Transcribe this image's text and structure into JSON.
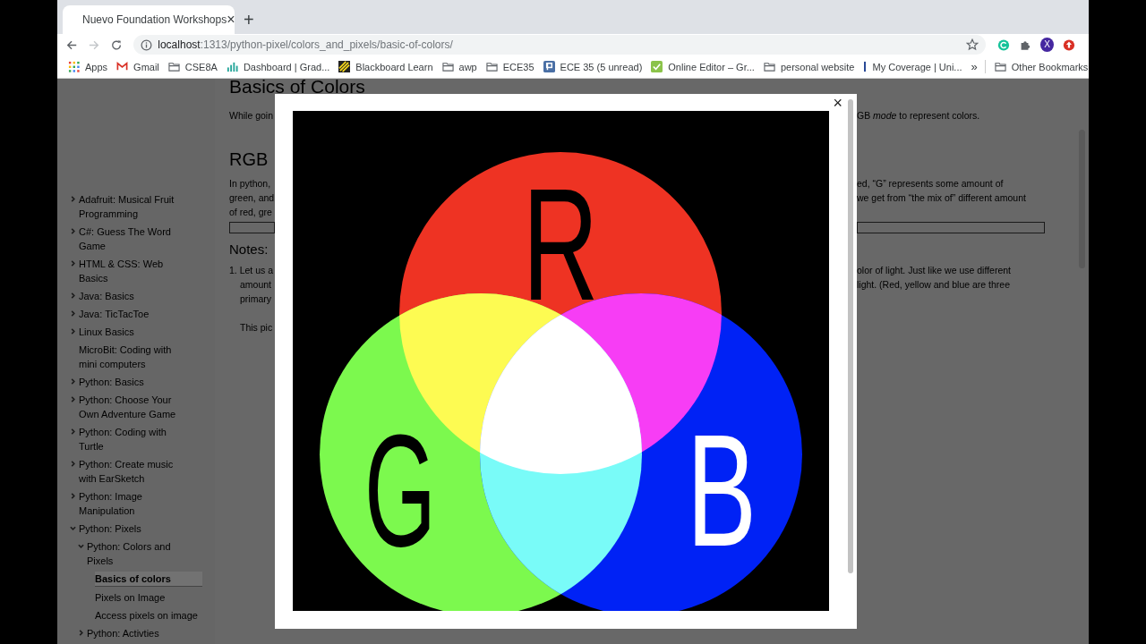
{
  "browser": {
    "tabs": [
      {
        "title": "Nuevo Foundation Workshops",
        "close": "×",
        "selected": true
      }
    ],
    "new_tab": "+",
    "nav": {
      "forward_disabled": true
    },
    "url": {
      "host": "localhost",
      "rest": ":1313/python-pixel/colors_and_pixels/basic-of-colors/"
    },
    "profile_initial": "X",
    "bookmarks": [
      {
        "kind": "apps",
        "label": "Apps"
      },
      {
        "kind": "mail",
        "label": "Gmail"
      },
      {
        "kind": "folder",
        "label": "CSE8A"
      },
      {
        "kind": "chart",
        "label": "Dashboard | Grad..."
      },
      {
        "kind": "board",
        "label": "Blackboard Learn"
      },
      {
        "kind": "folder",
        "label": "awp"
      },
      {
        "kind": "folder",
        "label": "ECE35"
      },
      {
        "kind": "square",
        "label": "ECE 35 (5 unread)"
      },
      {
        "kind": "check",
        "label": "Online Editor – Gr..."
      },
      {
        "kind": "folder",
        "label": "personal website"
      },
      {
        "kind": "bar",
        "label": "My Coverage | Uni..."
      }
    ],
    "bookmarks_more": "»",
    "other_bookmarks": "Other Bookmarks"
  },
  "sidebar": {
    "items": [
      {
        "kind": "section",
        "label": "Adafruit: Musical Fruit Programming",
        "expanded": false,
        "selected": false
      },
      {
        "kind": "section",
        "label": "C#: Guess The Word Game",
        "expanded": false,
        "selected": false
      },
      {
        "kind": "section",
        "label": "HTML & CSS: Web Basics",
        "expanded": false,
        "selected": false
      },
      {
        "kind": "section",
        "label": "Java: Basics",
        "expanded": false,
        "selected": false
      },
      {
        "kind": "section",
        "label": "Java: TicTacToe",
        "expanded": false,
        "selected": false
      },
      {
        "kind": "section",
        "label": "Linux Basics",
        "expanded": false,
        "selected": false
      },
      {
        "kind": "page",
        "label": "MicroBit: Coding with mini computers",
        "selected": false
      },
      {
        "kind": "section",
        "label": "Python: Basics",
        "expanded": false,
        "selected": false
      },
      {
        "kind": "section",
        "label": "Python: Choose Your Own Adventure Game",
        "expanded": false,
        "selected": false
      },
      {
        "kind": "section",
        "label": "Python: Coding with Turtle",
        "expanded": false,
        "selected": false
      },
      {
        "kind": "section",
        "label": "Python: Create music with EarSketch",
        "expanded": false,
        "selected": false
      },
      {
        "kind": "section",
        "label": "Python: Image Manipulation",
        "expanded": false,
        "selected": false
      },
      {
        "kind": "section",
        "label": "Python: Pixels",
        "expanded": true,
        "selected": false,
        "children": [
          {
            "kind": "section",
            "label": "Python: Colors and Pixels",
            "expanded": true,
            "selected": false,
            "children": [
              {
                "kind": "page",
                "label": "Basics of colors",
                "selected": true
              },
              {
                "kind": "page",
                "label": "Pixels on Image",
                "selected": false
              },
              {
                "kind": "page",
                "label": "Access pixels on image",
                "selected": false
              }
            ]
          },
          {
            "kind": "section",
            "label": "Python: Activties",
            "expanded": false,
            "selected": false
          }
        ]
      }
    ]
  },
  "article": {
    "title": "Basics of Colors",
    "rows": [
      {
        "kind": "para",
        "left": "While goin",
        "right": "GB *mode* to represent colors."
      },
      {
        "kind": "heading",
        "left": "RGB"
      },
      {
        "kind": "para",
        "left": "In python,",
        "right": "ed, “G” represents some amount of"
      },
      {
        "kind": "para",
        "left": "green, and",
        "right": "we get from “the mix of” different amount"
      },
      {
        "kind": "para",
        "left": "of red, gre"
      },
      {
        "kind": "code"
      },
      {
        "kind": "subheading",
        "left": "Notes:"
      },
      {
        "kind": "list",
        "left": "1. Let us a",
        "right": "olor of light. Just like we use different"
      },
      {
        "kind": "list",
        "left": "amount",
        "right": "light. (Red, yellow and blue are three"
      },
      {
        "kind": "list",
        "left": "primary"
      },
      {
        "kind": "indent",
        "left": "This pic"
      }
    ]
  },
  "lightbox": {
    "close": "×",
    "labels": [
      {
        "text": "R",
        "color": "#000000"
      },
      {
        "text": "G",
        "color": "#000000"
      },
      {
        "text": "B",
        "color": "#ffffff"
      }
    ]
  }
}
